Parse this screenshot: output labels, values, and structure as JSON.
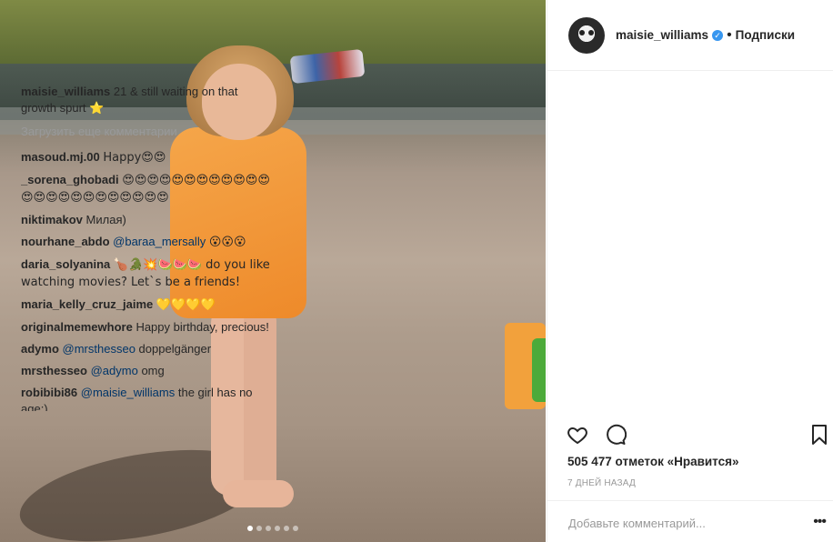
{
  "post": {
    "author": "maisie_williams",
    "follow_label": "Подписки",
    "separator": "•",
    "verified_mark": "✓",
    "caption": "21 & still waiting on that growth spurt ⭐",
    "load_more": "Загрузить еще комментарии",
    "comments": [
      {
        "user": "masoud.mj.00",
        "text": "Happy😍😍"
      },
      {
        "user": "_sorena_ghobadi",
        "text": "😍😍😍😍😍😍😍😍😍😍😍😍😍😍😍😍😍😍😍😍😍😍😍😍"
      },
      {
        "user": "niktimakov",
        "text": "Милая)"
      },
      {
        "user": "nourhane_abdo",
        "mention": "@baraa_mersally",
        "text": "😮😮😮"
      },
      {
        "user": "daria_solyanina",
        "text": "🍗🐊💥🍉🍉🍉 do you like watching movies? Let`s be a friends!"
      },
      {
        "user": "maria_kelly_cruz_jaime",
        "text": "💛💛💛💛"
      },
      {
        "user": "originalmemewhore",
        "text": "Happy birthday, precious!"
      },
      {
        "user": "adymo",
        "mention": "@mrsthesseo",
        "text": "doppelgänger"
      },
      {
        "user": "mrsthesseo",
        "mention": "@adymo",
        "text": "omg"
      },
      {
        "user": "robibibi86",
        "mention": "@maisie_williams",
        "text": "the girl has no age:)"
      }
    ],
    "likes": "505 477 отметок «Нравится»",
    "time": "7 ДНЕЙ НАЗАД",
    "add_comment_placeholder": "Добавьте комментарий...",
    "more_label": "•••"
  },
  "icons": [
    "heart-icon",
    "comment-icon",
    "bookmark-icon"
  ],
  "colors": {
    "link": "#003569",
    "verified": "#3897f0",
    "muted": "#999999"
  }
}
